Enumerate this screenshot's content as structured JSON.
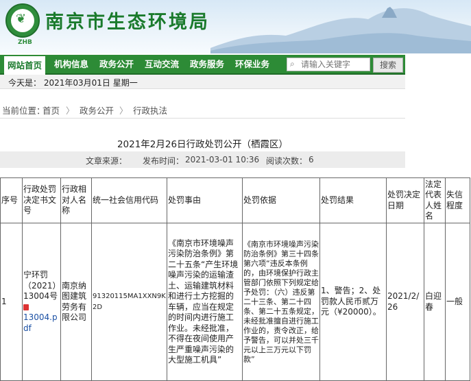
{
  "header": {
    "site_title": "南京市生态环境局",
    "logo_text": "ZHB"
  },
  "nav": {
    "items": [
      {
        "label": "网站首页",
        "active": true
      },
      {
        "label": "机构信息",
        "active": false
      },
      {
        "label": "政务公开",
        "active": false
      },
      {
        "label": "互动交流",
        "active": false
      },
      {
        "label": "政务服务",
        "active": false
      },
      {
        "label": "环保业务",
        "active": false
      }
    ],
    "search_placeholder": "请输入关键字",
    "search_button": "搜索"
  },
  "date_bar": {
    "text": "今天是：  2021年03月01日  星期一"
  },
  "breadcrumb": {
    "prefix": "当前位置：",
    "items": [
      "首页",
      "政务公开",
      "行政执法"
    ],
    "separator": "〉"
  },
  "article": {
    "title": "2021年2月26日行政处罚公开（栖霞区）",
    "source_label": "文章来源：",
    "publish_label": "发布时间：",
    "publish_time": "2021-03-01 10:36",
    "views_label": "阅读次数：",
    "views": "6"
  },
  "table": {
    "headers": [
      "序号",
      "行政处罚决定书文号",
      "行政相对人名称",
      "统一社会信用代码",
      "处罚事由",
      "处罚依据",
      "处罚结果",
      "处罚决定日期",
      "法定代表人姓名",
      "失信程度"
    ],
    "rows": [
      {
        "seq": "1",
        "doc_no": "宁环罚（2021）13004号",
        "pdf_link": "13004.pdf",
        "party": "南京纳图建筑劳务有限公司",
        "credit_code": "91320115MA1XXN9K2D",
        "reason": "《南京市环境噪声污染防治条例》第二十五条“产生环境噪声污染的运输渣土、运输建筑材料和进行土方挖掘的车辆，应当在规定的时间内进行施工作业。未经批准，不得在夜间使用产生严重噪声污染的大型施工机具”",
        "basis": "《南京市环境噪声污染防治条例》第三十四条第六项“违反本条例的，由环境保护行政主管部门依照下列规定给予处罚：（六）违反第二十三条、第二十四条、第二十五条规定，未经批准擅自进行施工作业的，责令改正，给予警告，可以并处三千元以上三万元以下罚款”",
        "result": "1、警告；2、处罚款人民币贰万元（¥20000）。",
        "date": "2021/2/26",
        "legal_rep": "白迎春",
        "credit_level": "一般"
      }
    ]
  },
  "colors": {
    "nav_green": "#2d8b36",
    "title_green": "#1a7a2c",
    "link_blue": "#1a4fa3"
  }
}
